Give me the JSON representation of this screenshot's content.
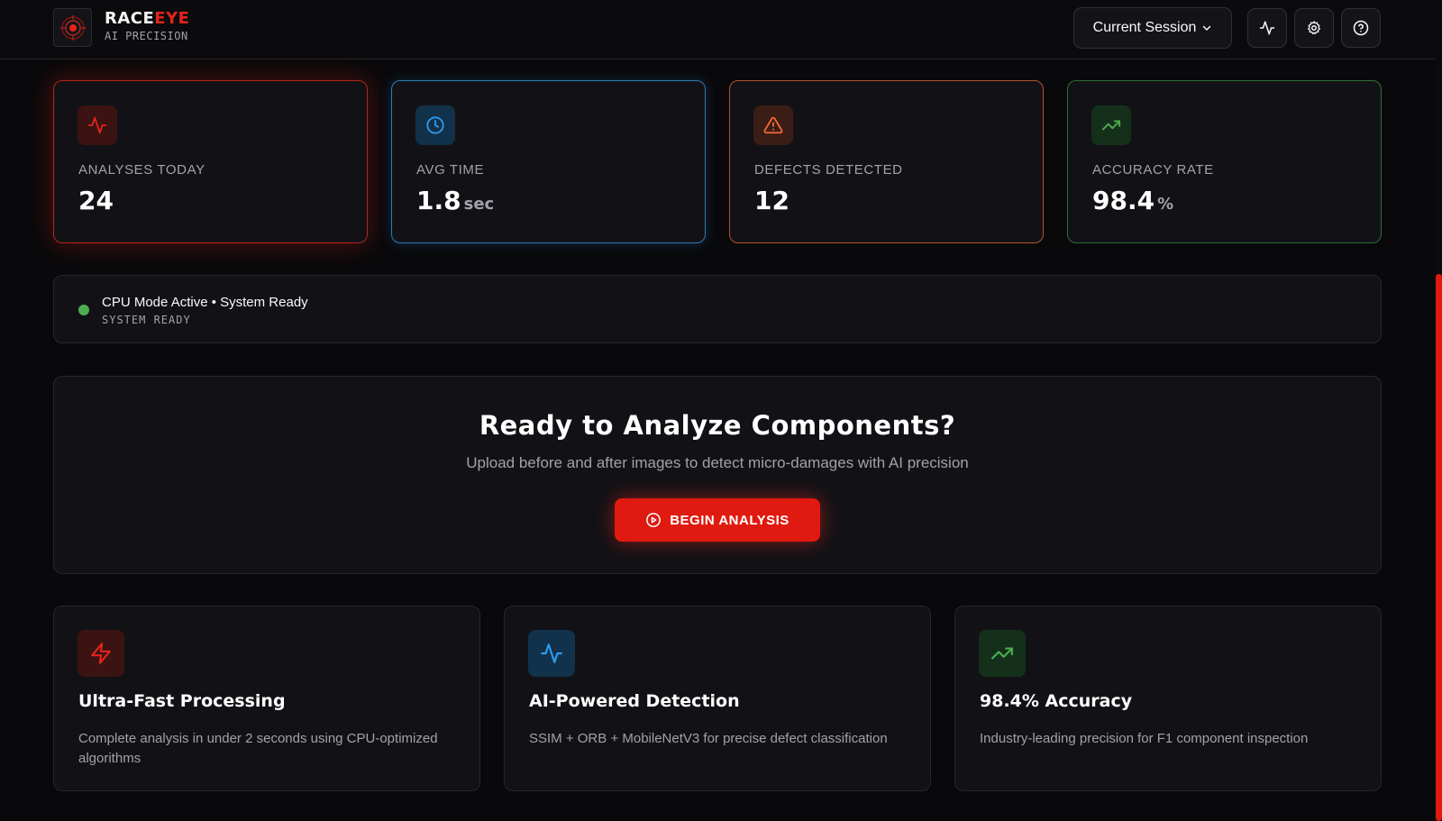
{
  "brand": {
    "name_part1": "RACE",
    "name_part2": "EYE",
    "subtitle": "AI PRECISION"
  },
  "header": {
    "session_label": "Current Session"
  },
  "stats": [
    {
      "label": "ANALYSES TODAY",
      "value": "24",
      "unit": "",
      "icon": "activity-icon",
      "color": "#e5231b"
    },
    {
      "label": "AVG TIME",
      "value": "1.8",
      "unit": "sec",
      "icon": "clock-icon",
      "color": "#2e9bef"
    },
    {
      "label": "DEFECTS DETECTED",
      "value": "12",
      "unit": "",
      "icon": "alert-triangle-icon",
      "color": "#f06a3a"
    },
    {
      "label": "ACCURACY RATE",
      "value": "98.4",
      "unit": "%",
      "icon": "trending-up-icon",
      "color": "#4caf50"
    }
  ],
  "status": {
    "main": "CPU Mode Active • System Ready",
    "sub": "SYSTEM READY",
    "color": "#4caf50"
  },
  "hero": {
    "title": "Ready to Analyze Components?",
    "subtitle": "Upload before and after images to detect micro-damages with AI precision",
    "button_label": "BEGIN ANALYSIS"
  },
  "features": [
    {
      "title": "Ultra-Fast Processing",
      "description": "Complete analysis in under 2 seconds using CPU-optimized algorithms",
      "icon": "zap-icon"
    },
    {
      "title": "AI-Powered Detection",
      "description": "SSIM + ORB + MobileNetV3 for precise defect classification",
      "icon": "activity-icon"
    },
    {
      "title": "98.4% Accuracy",
      "description": "Industry-leading precision for F1 component inspection",
      "icon": "trending-up-icon"
    }
  ],
  "colors": {
    "accent": "#e01a10",
    "background": "#09090b",
    "card": "#121216"
  }
}
